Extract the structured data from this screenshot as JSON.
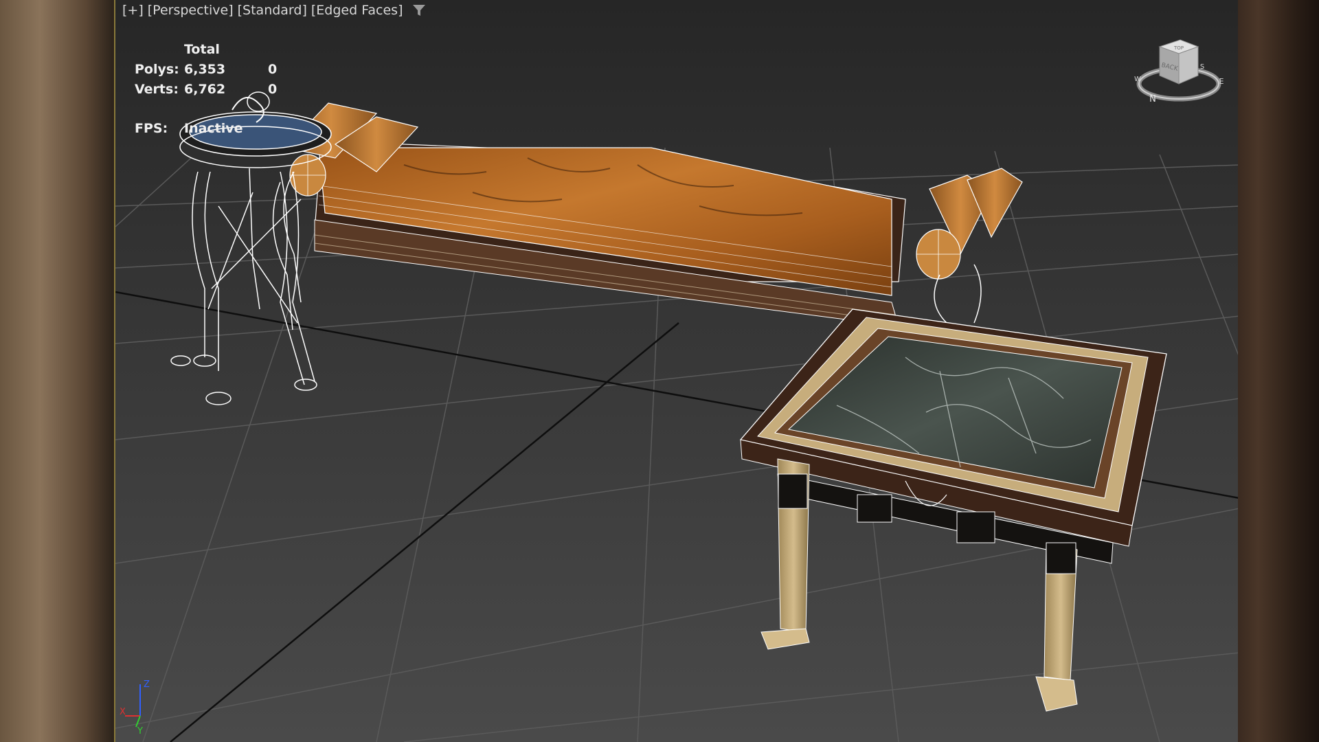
{
  "viewport": {
    "labels": [
      "[+]",
      "[Perspective]",
      "[Standard]",
      "[Edged Faces]"
    ],
    "filter_icon": "filter-icon"
  },
  "stats": {
    "header": "Total",
    "polys_label": "Polys:",
    "polys_total": "6,353",
    "polys_sel": "0",
    "verts_label": "Verts:",
    "verts_total": "6,762",
    "verts_sel": "0",
    "fps_label": "FPS:",
    "fps_value": "Inactive"
  },
  "viewcube": {
    "face_label": "BACK",
    "top_label": "TOP",
    "compass": [
      "N",
      "E",
      "S",
      "W"
    ]
  },
  "axis": {
    "x": "X",
    "y": "Y",
    "z": "Z"
  },
  "colors": {
    "wire": "#ffffff",
    "wood": "#b86a24",
    "marble": "#3a423c",
    "gold_trim": "#c7ad7c",
    "blue_top": "#3a5478",
    "axis_x": "#e03030",
    "axis_y": "#30d030",
    "axis_z": "#3060ff"
  }
}
